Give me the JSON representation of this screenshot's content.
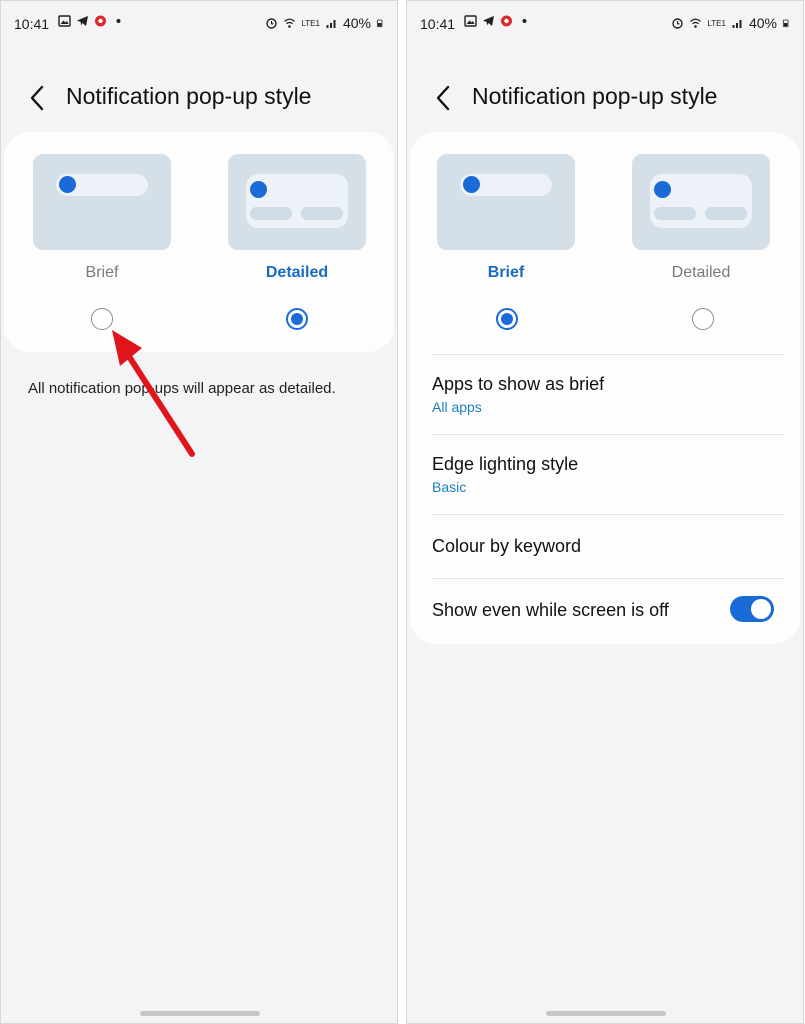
{
  "status_bar": {
    "time": "10:41",
    "battery": "40%",
    "network": "LTE1",
    "icons": [
      "gallery-icon",
      "telegram-icon",
      "app-badge-icon",
      "dot-icon",
      "alarm-icon",
      "wifi-icon",
      "volte-icon",
      "signal-icon",
      "battery-icon"
    ]
  },
  "screens": [
    {
      "header": {
        "back_icon": "back-icon",
        "title": "Notification pop-up style"
      },
      "options": [
        {
          "label": "Brief",
          "selected": false
        },
        {
          "label": "Detailed",
          "selected": true
        }
      ],
      "description": "All notification pop-ups will appear as detailed.",
      "annotation": "red-arrow-pointing-to-brief-radio"
    },
    {
      "header": {
        "back_icon": "back-icon",
        "title": "Notification pop-up style"
      },
      "options": [
        {
          "label": "Brief",
          "selected": true
        },
        {
          "label": "Detailed",
          "selected": false
        }
      ],
      "settings": [
        {
          "title": "Apps to show as brief",
          "subtitle": "All apps"
        },
        {
          "title": "Edge lighting style",
          "subtitle": "Basic"
        },
        {
          "title": "Colour by keyword"
        },
        {
          "title": "Show even while screen is off",
          "toggle_on": true
        }
      ]
    }
  ],
  "colors": {
    "accent": "#1a6bd8",
    "selected_label": "#1a6bc0",
    "subtitle": "#1d7fbd",
    "preview_bg": "#d4dfe7",
    "arrow": "#e0151b"
  }
}
